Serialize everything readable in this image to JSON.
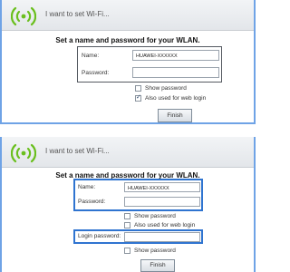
{
  "panels": [
    {
      "header_title": "I want to set Wi-Fi...",
      "subtitle": "Set a name and password for your WLAN.",
      "name_label": "Name:",
      "name_value": "HUAWEI-XXXXXX",
      "password_label": "Password:",
      "show_password_label": "Show password",
      "show_password_checked": false,
      "web_login_label": "Also used for web login",
      "web_login_checked": true,
      "finish_label": "Finish"
    },
    {
      "header_title": "I want to set Wi-Fi...",
      "subtitle": "Set a name and password for your WLAN.",
      "name_label": "Name:",
      "name_value": "HUAWEI-XXXXXX",
      "password_label": "Password:",
      "show_password_label": "Show password",
      "show_password_checked": false,
      "web_login_label": "Also used for web login",
      "web_login_checked": false,
      "login_password_label": "Login password:",
      "login_show_password_label": "Show password",
      "login_show_password_checked": false,
      "finish_label": "Finish"
    }
  ],
  "icons": {
    "wifi": "wifi-icon",
    "check": "check-icon"
  },
  "colors": {
    "panel_border": "#6fa3e6",
    "highlight_border": "#2f74d0",
    "wifi_icon": "#6abf1e"
  }
}
